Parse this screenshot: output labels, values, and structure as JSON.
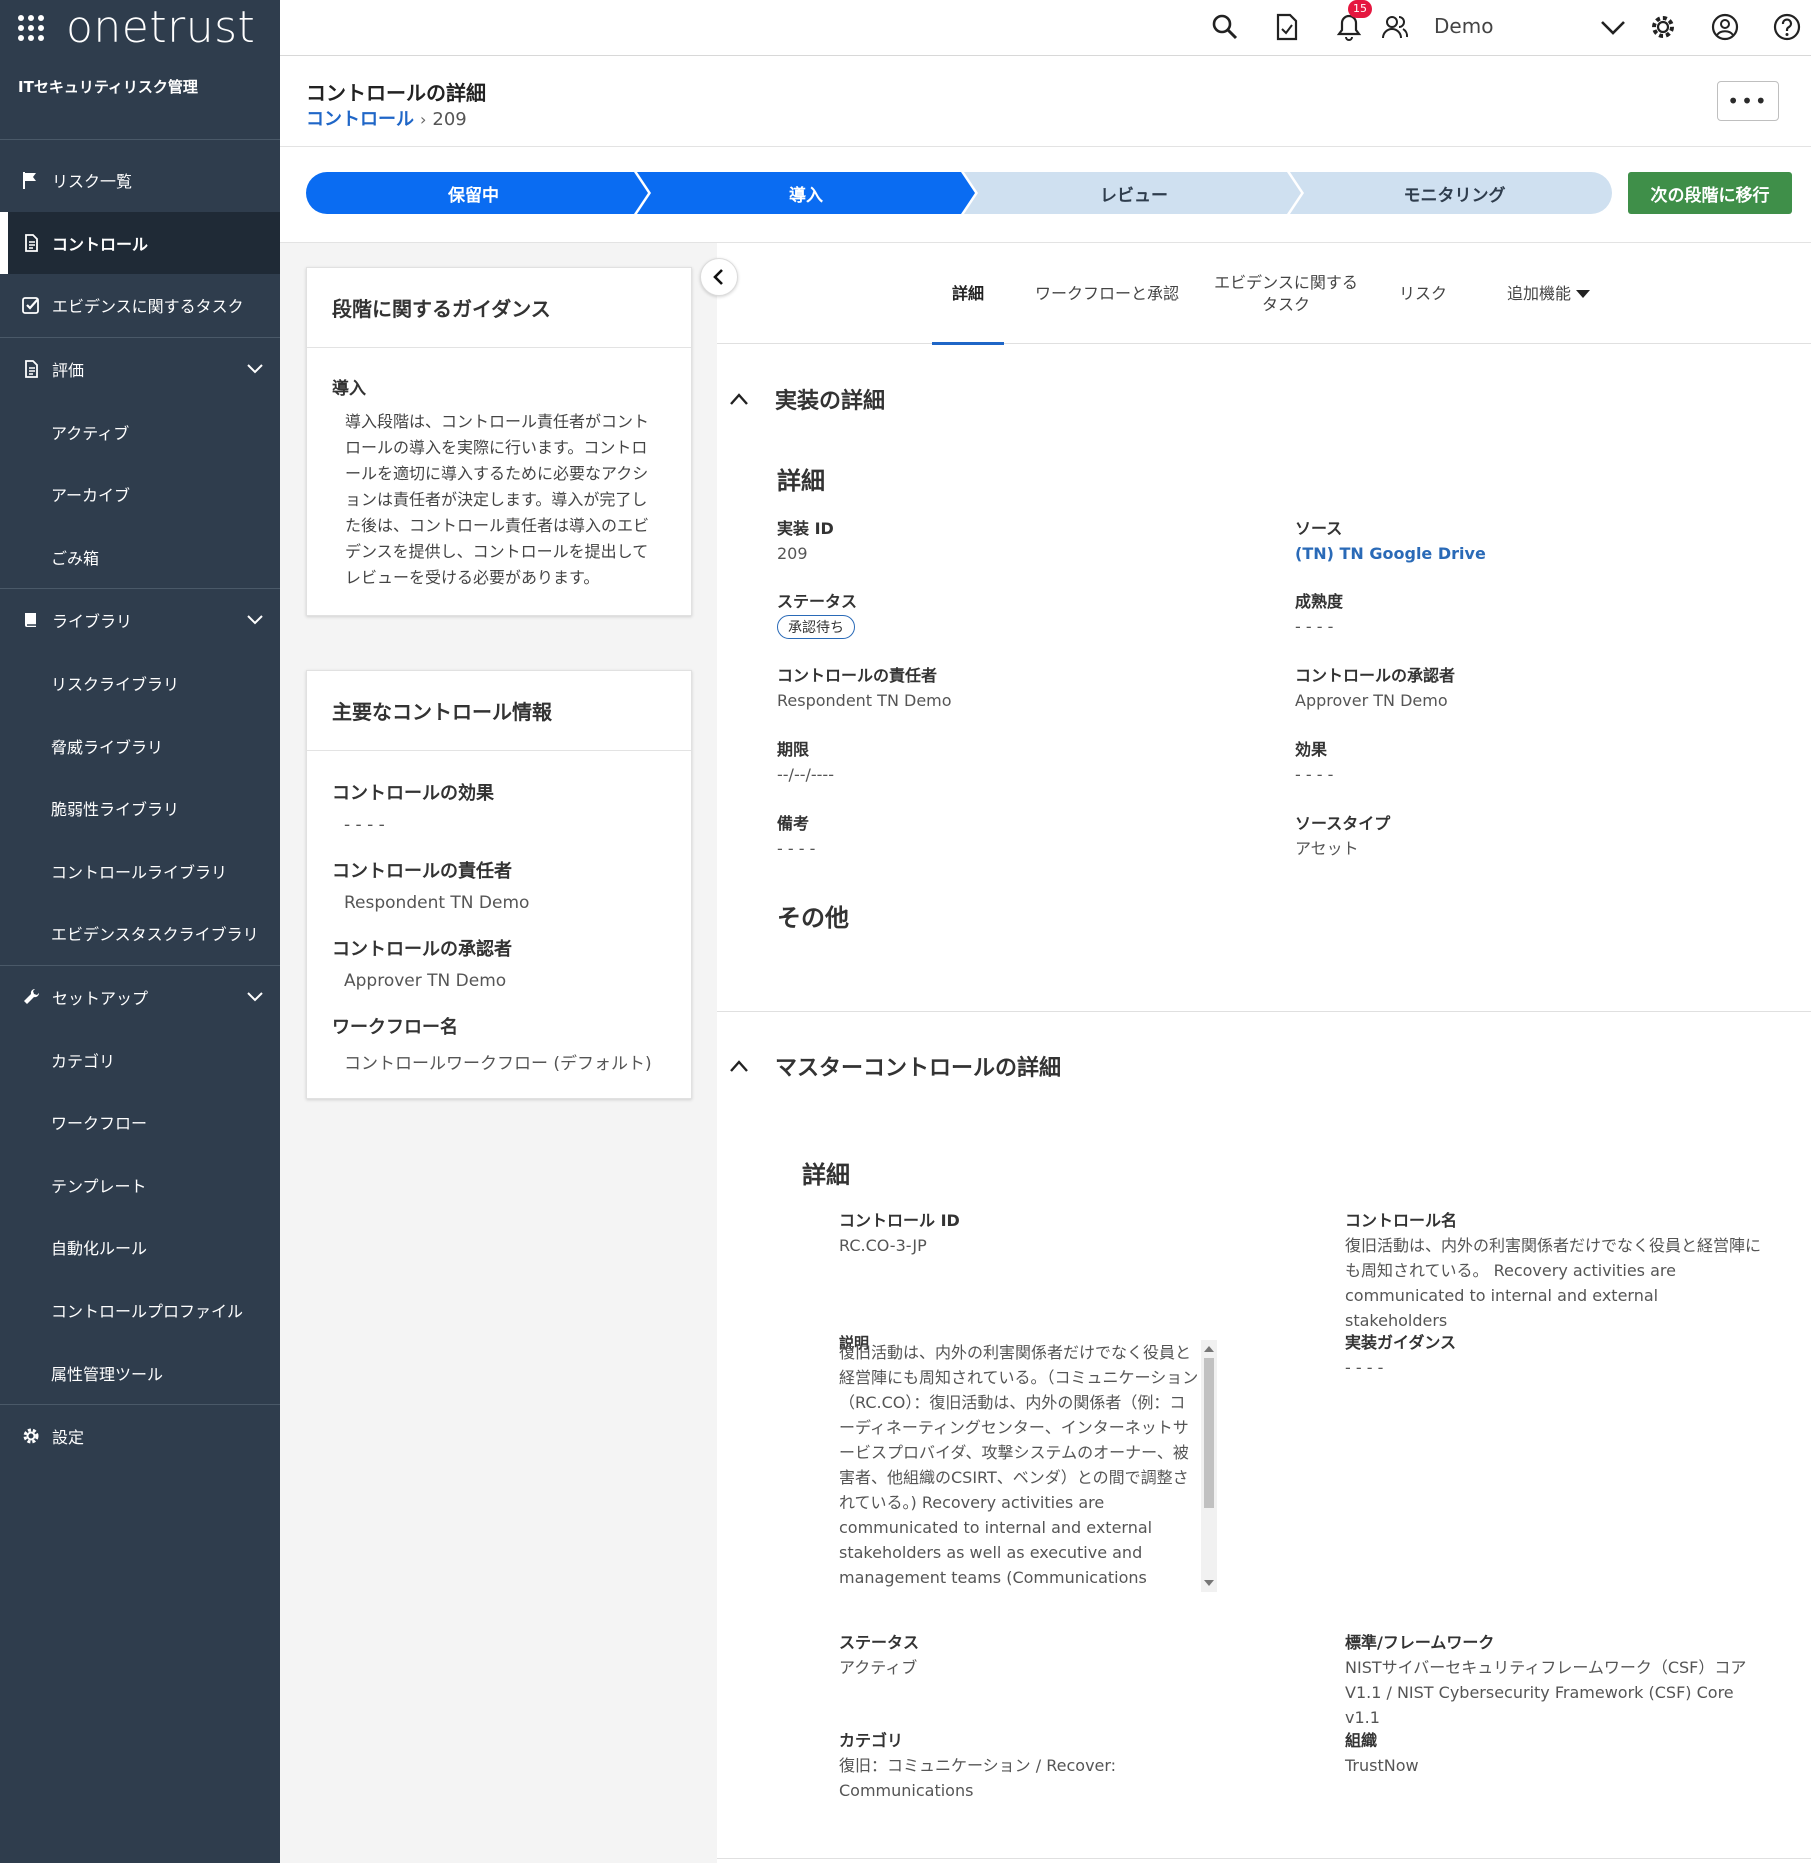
{
  "brand": {
    "logo": "onetrust",
    "module": "ITセキュリティリスク管理"
  },
  "nav": {
    "risks": "リスク一覧",
    "controls": "コントロール",
    "evidence_tasks": "エビデンスに関するタスク",
    "assessment": "評価",
    "active": "アクティブ",
    "archive": "アーカイブ",
    "trash": "ごみ箱",
    "library": "ライブラリ",
    "risk_library": "リスクライブラリ",
    "threat_library": "脅威ライブラリ",
    "vuln_library": "脆弱性ライブラリ",
    "control_library": "コントロールライブラリ",
    "evidence_library": "エビデンスタスクライブラリ",
    "setup": "セットアップ",
    "category": "カテゴリ",
    "workflow": "ワークフロー",
    "template": "テンプレート",
    "automation": "自動化ルール",
    "control_profile": "コントロールプロファイル",
    "attribute_tool": "属性管理ツール",
    "settings": "設定"
  },
  "topbar": {
    "notifications": "15",
    "user": "Demo"
  },
  "header": {
    "title": "コントロールの詳細",
    "crumb": "コントロール",
    "id": "209",
    "more": "•••"
  },
  "stages": {
    "s1": "保留中",
    "s2": "導入",
    "s3": "レビュー",
    "s4": "モニタリング",
    "next": "次の段階に移行"
  },
  "guidance": {
    "title": "段階に関するガイダンス",
    "stage": "導入",
    "text": "導入段階は、コントロール責任者がコントロールの導入を実際に行います。コントロールを適切に導入するために必要なアクションは責任者が決定します。導入が完了した後は、コントロール責任者は導入のエビデンスを提供し、コントロールを提出してレビューを受ける必要があります。"
  },
  "key_info": {
    "title": "主要なコントロール情報",
    "effect_label": "コントロールの効果",
    "effect": "- - - -",
    "owner_label": "コントロールの責任者",
    "owner": "Respondent TN Demo",
    "approver_label": "コントロールの承認者",
    "approver": "Approver TN Demo",
    "workflow_label": "ワークフロー名",
    "workflow": "コントロールワークフロー (デフォルト)"
  },
  "tabs": {
    "details": "詳細",
    "workflow": "ワークフローと承認",
    "evidence": "エビデンスに関する タスク",
    "risk": "リスク",
    "more": "追加機能"
  },
  "impl": {
    "section": "実装の詳細",
    "details": "詳細",
    "id_label": "実装 ID",
    "id": "209",
    "source_label": "ソース",
    "source": "(TN) TN Google Drive",
    "status_label": "ステータス",
    "status": "承認待ち",
    "maturity_label": "成熟度",
    "maturity": "- - - -",
    "owner_label": "コントロールの責任者",
    "owner": "Respondent TN Demo",
    "approver_label": "コントロールの承認者",
    "approver": "Approver TN Demo",
    "due_label": "期限",
    "due": "--/--/----",
    "effect_label": "効果",
    "effect": "- - - -",
    "notes_label": "備考",
    "notes": "- - - -",
    "source_type_label": "ソースタイプ",
    "source_type": "アセット",
    "other": "その他"
  },
  "master": {
    "section": "マスターコントロールの詳細",
    "details": "詳細",
    "cid_label": "コントロール ID",
    "cid": "RC.CO-3-JP",
    "cname_label": "コントロール名",
    "cname": "復旧活動は、内外の利害関係者だけでなく役員と経営陣にも周知されている。 Recovery activities are communicated to internal and external stakeholders",
    "desc_label": "説明",
    "desc": "復旧活動は、内外の利害関係者だけでなく役員と経営陣にも周知されている。（コミュニケーション（RC.CO）：復旧活動は、内外の関係者（例：コーディネーティングセンター、インターネットサービスプロバイダ、攻撃システムのオーナー、被害者、他組織のCSIRT、ベンダ）との間で調整されている。) Recovery activities are communicated to internal and external stakeholders as well as executive and management teams (Communications (RC.CO): Restoration activities are coordinated with internal and external parties",
    "guidance_label": "実装ガイダンス",
    "guidance": "- - - -",
    "status_label": "ステータス",
    "status": "アクティブ",
    "framework_label": "標準/フレームワーク",
    "framework": "NISTサイバーセキュリティフレームワーク（CSF）コア V1.1 / NIST Cybersecurity Framework (CSF) Core v1.1",
    "category_label": "カテゴリ",
    "category": "復旧：コミュニケーション / Recover: Communications",
    "org_label": "組織",
    "org": "TrustNow"
  },
  "colors": {
    "sidebar": "#2f3d4d",
    "active_stage": "#0a6cf2",
    "inactive_stage": "#cfe0f0",
    "next_button": "#3f8f49",
    "link": "#1f66c7"
  }
}
